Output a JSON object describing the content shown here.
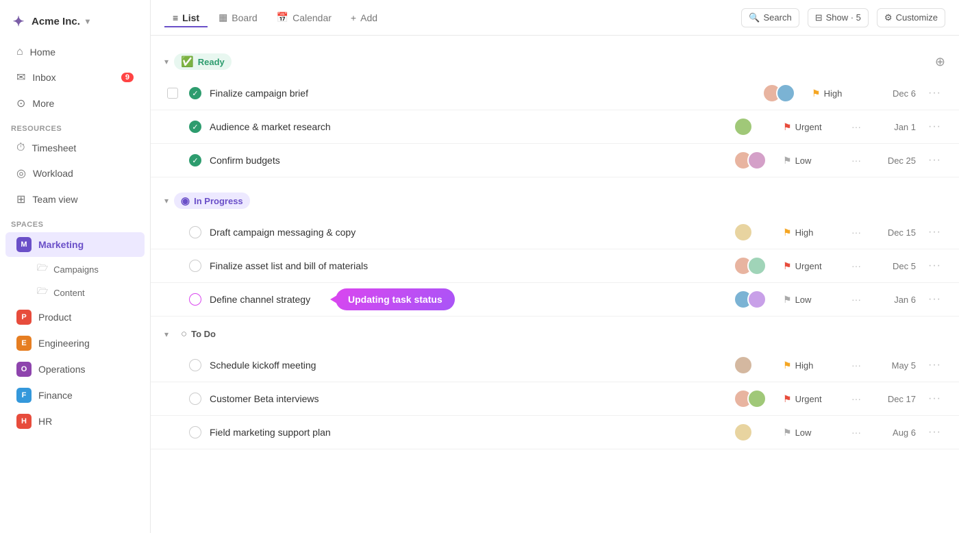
{
  "app": {
    "name": "Acme Inc.",
    "logo_symbol": "✦"
  },
  "sidebar": {
    "nav": [
      {
        "id": "home",
        "label": "Home",
        "icon": "⌂"
      },
      {
        "id": "inbox",
        "label": "Inbox",
        "icon": "✉",
        "badge": "9"
      },
      {
        "id": "more",
        "label": "More",
        "icon": "⊙"
      }
    ],
    "resources_label": "Resources",
    "resources": [
      {
        "id": "timesheet",
        "label": "Timesheet",
        "icon": "⏱"
      },
      {
        "id": "workload",
        "label": "Workload",
        "icon": "◎"
      },
      {
        "id": "teamview",
        "label": "Team view",
        "icon": "⊞"
      }
    ],
    "spaces_label": "Spaces",
    "spaces": [
      {
        "id": "marketing",
        "label": "Marketing",
        "badge": "M",
        "color": "space-m",
        "active": true,
        "children": [
          {
            "id": "campaigns",
            "label": "Campaigns"
          },
          {
            "id": "content",
            "label": "Content"
          }
        ]
      },
      {
        "id": "product",
        "label": "Product",
        "badge": "P",
        "color": "space-p"
      },
      {
        "id": "engineering",
        "label": "Engineering",
        "badge": "E",
        "color": "space-e"
      },
      {
        "id": "operations",
        "label": "Operations",
        "badge": "O",
        "color": "space-o"
      },
      {
        "id": "finance",
        "label": "Finance",
        "badge": "F",
        "color": "space-f"
      },
      {
        "id": "hr",
        "label": "HR",
        "badge": "H",
        "color": "space-h"
      }
    ]
  },
  "topbar": {
    "tabs": [
      {
        "id": "list",
        "label": "List",
        "icon": "≡",
        "active": true
      },
      {
        "id": "board",
        "label": "Board",
        "icon": "▦"
      },
      {
        "id": "calendar",
        "label": "Calendar",
        "icon": "📅"
      },
      {
        "id": "add",
        "label": "Add",
        "icon": "+"
      }
    ],
    "search_label": "Search",
    "show_label": "Show · 5",
    "customize_label": "Customize"
  },
  "sections": [
    {
      "id": "ready",
      "label": "Ready",
      "style": "ready",
      "tasks": [
        {
          "id": "t1",
          "name": "Finalize campaign brief",
          "checked": true,
          "priority": "High",
          "priority_style": "p-high",
          "date": "Dec 6",
          "avatars": [
            "av1",
            "av2"
          ],
          "has_row_select": true
        },
        {
          "id": "t2",
          "name": "Audience & market research",
          "checked": true,
          "priority": "Urgent",
          "priority_style": "p-urgent",
          "date": "Jan 1",
          "avatars": [
            "av3"
          ],
          "has_extra_dots": true
        },
        {
          "id": "t3",
          "name": "Confirm budgets",
          "checked": true,
          "priority": "Low",
          "priority_style": "p-low",
          "date": "Dec 25",
          "avatars": [
            "av1",
            "av4"
          ],
          "has_extra_dots": true
        }
      ]
    },
    {
      "id": "inprogress",
      "label": "In Progress",
      "style": "inprogress",
      "tasks": [
        {
          "id": "t4",
          "name": "Draft campaign messaging & copy",
          "checked": false,
          "priority": "High",
          "priority_style": "p-high",
          "date": "Dec 15",
          "avatars": [
            "av5"
          ],
          "has_extra_dots": true
        },
        {
          "id": "t5",
          "name": "Finalize asset list and bill of materials",
          "checked": false,
          "priority": "Urgent",
          "priority_style": "p-urgent",
          "date": "Dec 5",
          "avatars": [
            "av1",
            "av6"
          ],
          "has_extra_dots": true
        },
        {
          "id": "t6",
          "name": "Define channel strategy",
          "checked": false,
          "priority": "Low",
          "priority_style": "p-low",
          "date": "Jan 6",
          "avatars": [
            "av2",
            "av7"
          ],
          "has_extra_dots": true,
          "has_tooltip": true,
          "tooltip": "Updating task status"
        }
      ]
    },
    {
      "id": "todo",
      "label": "To Do",
      "style": "todo",
      "tasks": [
        {
          "id": "t7",
          "name": "Schedule kickoff meeting",
          "checked": false,
          "priority": "High",
          "priority_style": "p-high",
          "date": "May 5",
          "avatars": [
            "av8"
          ],
          "has_extra_dots": true
        },
        {
          "id": "t8",
          "name": "Customer Beta interviews",
          "checked": false,
          "priority": "Urgent",
          "priority_style": "p-urgent",
          "date": "Dec 17",
          "avatars": [
            "av1",
            "av3"
          ],
          "has_extra_dots": true
        },
        {
          "id": "t9",
          "name": "Field marketing support plan",
          "checked": false,
          "priority": "Low",
          "priority_style": "p-low",
          "date": "Aug 6",
          "avatars": [
            "av5"
          ],
          "has_extra_dots": true
        }
      ]
    }
  ]
}
